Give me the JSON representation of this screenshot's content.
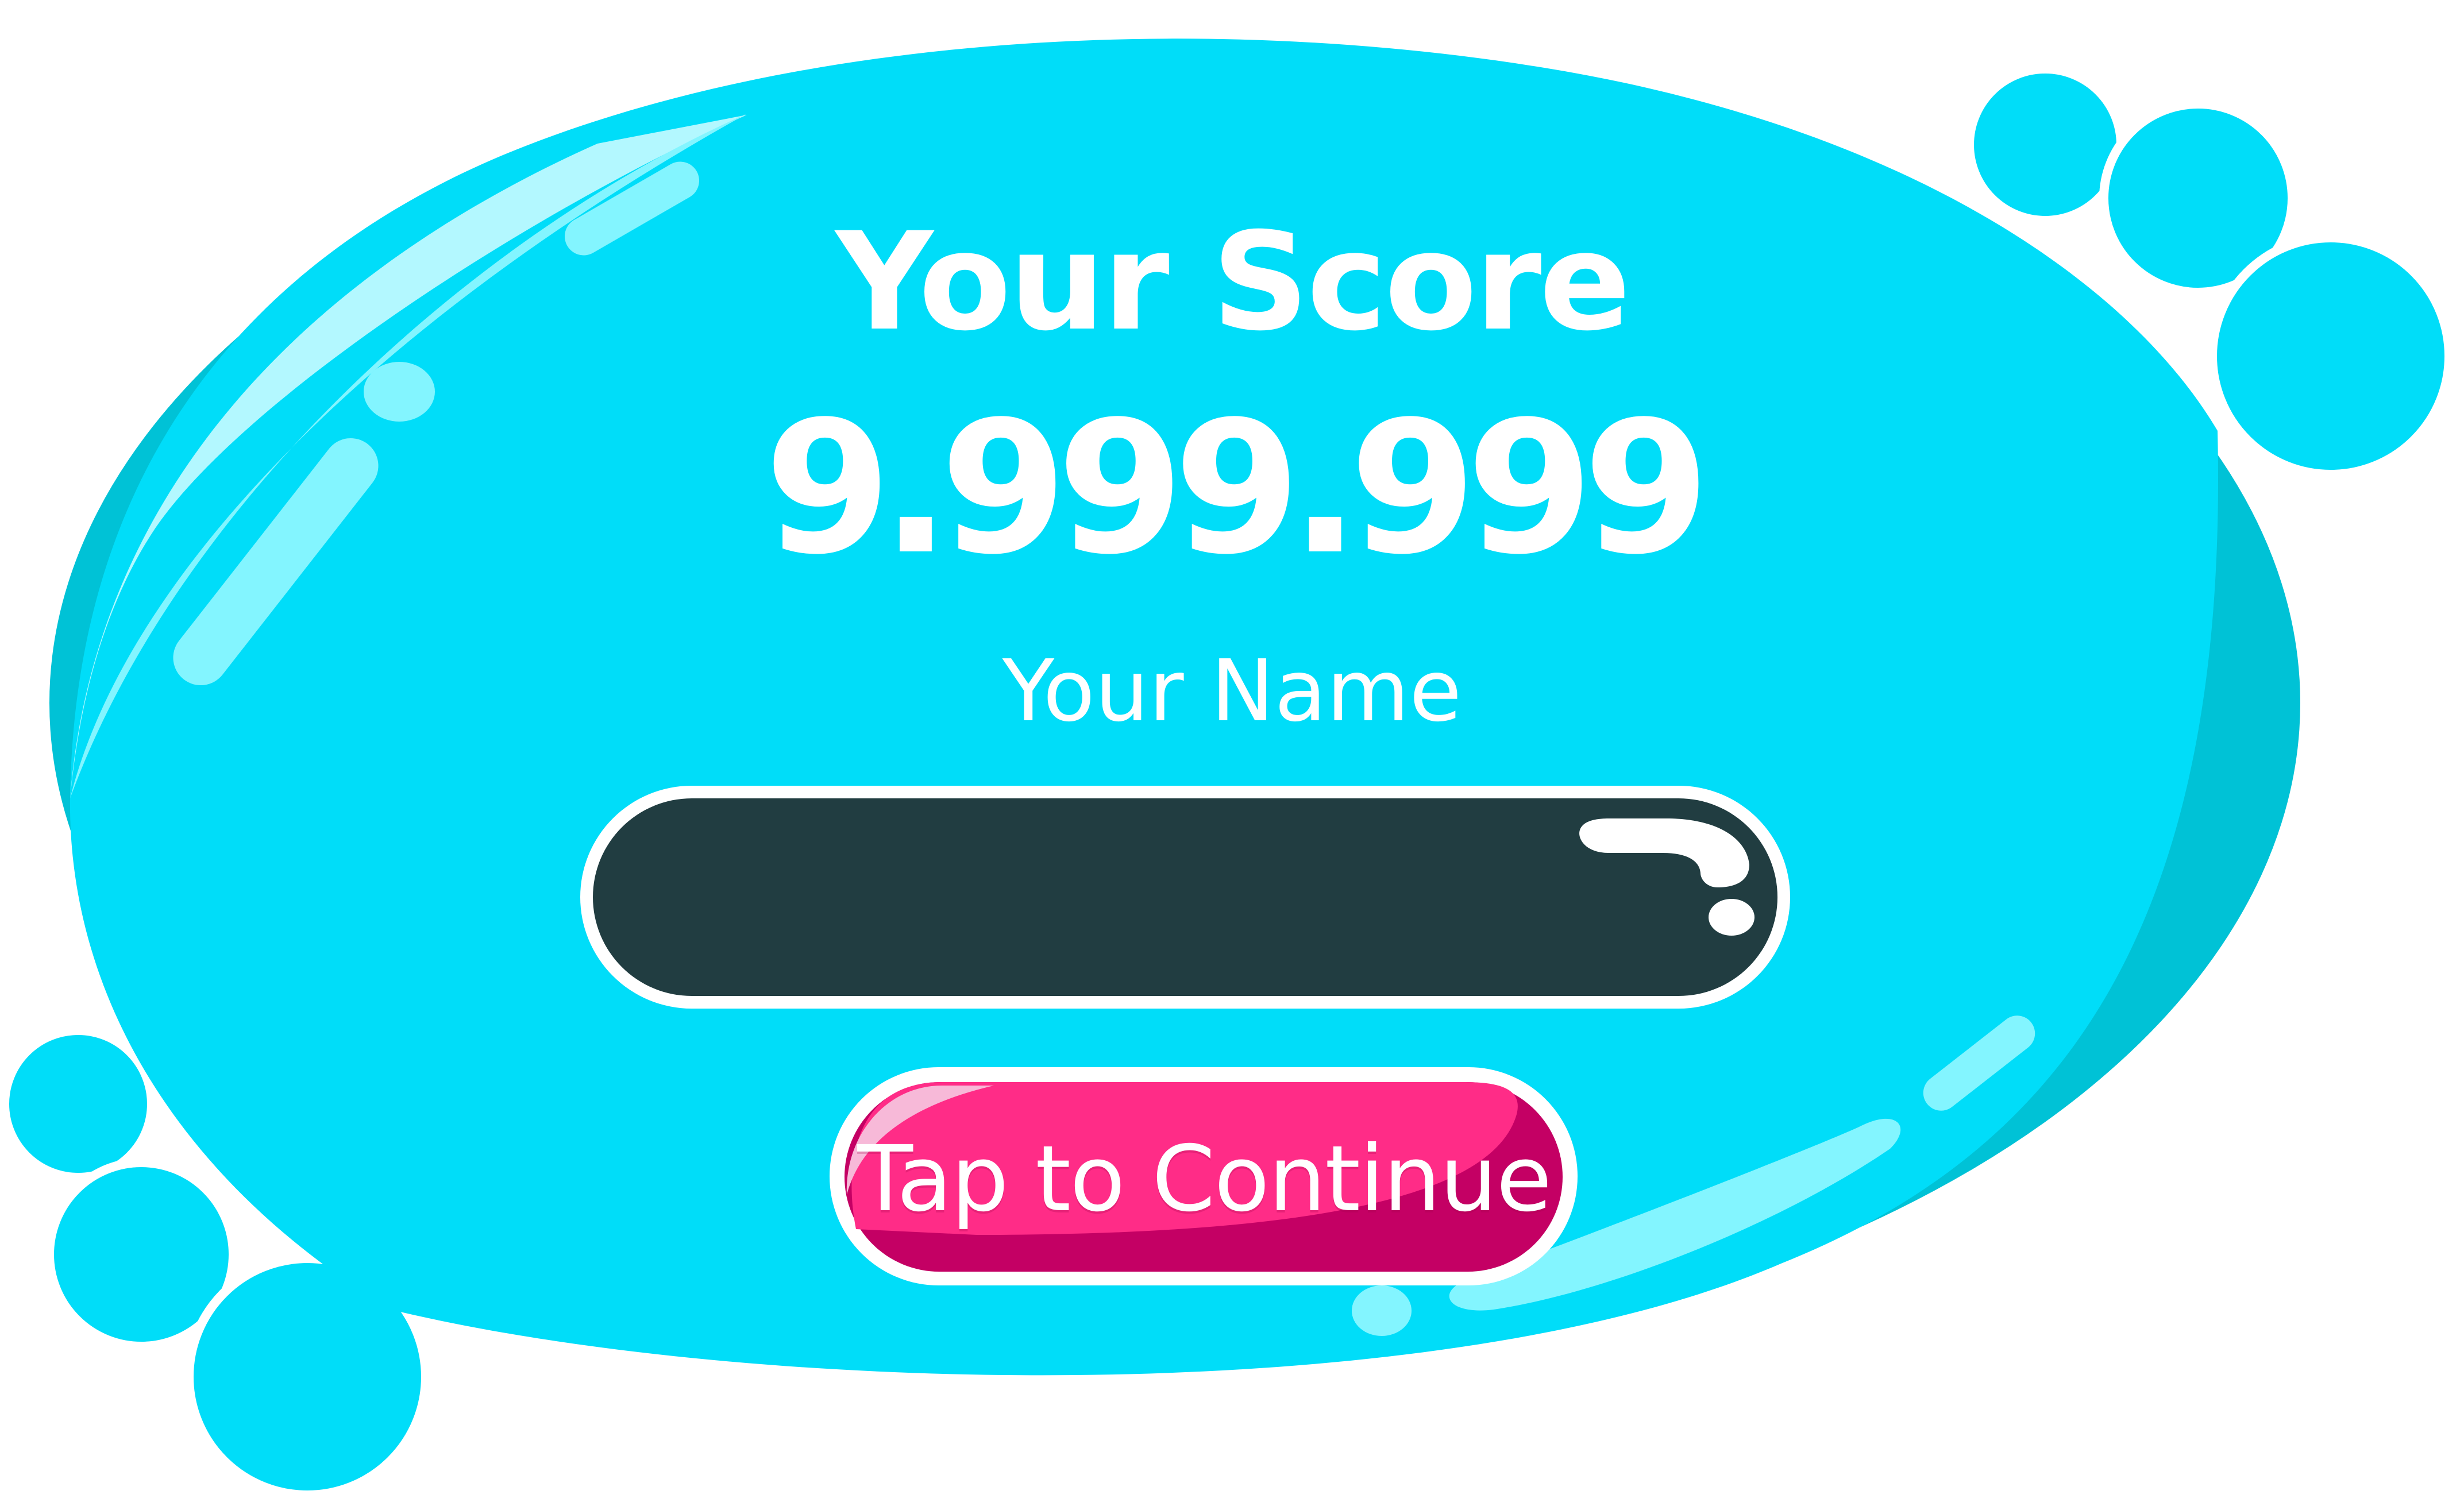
{
  "panel": {
    "score_title": "Your Score",
    "score_value": "9.999.999",
    "name_label": "Your Name"
  },
  "name_field": {
    "value": "",
    "placeholder": ""
  },
  "continue_button": {
    "label": "Tap to Continue"
  },
  "colors": {
    "panel_fill": "#00DDF9",
    "panel_shadow": "#00C2D6",
    "highlight": "#83F5FF",
    "input_fill": "#213D41",
    "button_fill": "#FF2C87",
    "button_shadow": "#C40064",
    "button_highlight": "#F7B9D8",
    "bubble": "#00DDF9",
    "outline": "#FFFFFF"
  },
  "decor": {
    "bubble_icon": "bubble-cluster"
  }
}
